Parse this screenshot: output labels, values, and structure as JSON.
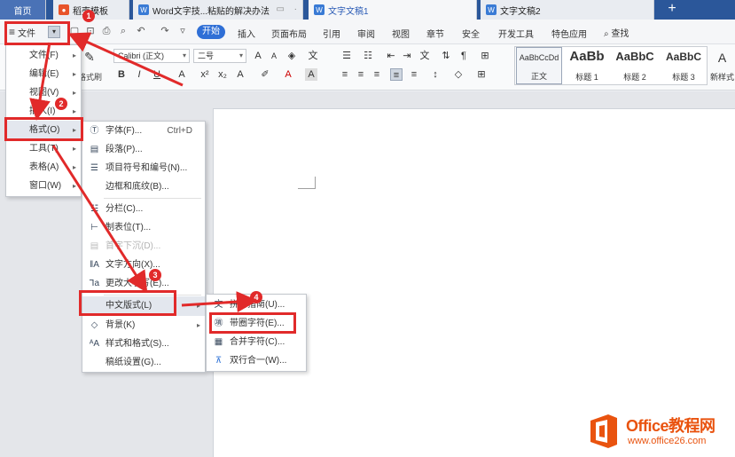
{
  "tabs": [
    {
      "label": "首页"
    },
    {
      "label": "稻壳模板"
    },
    {
      "label": "Word文字技...粘贴的解决办法"
    },
    {
      "label": "文字文稿1"
    },
    {
      "label": "文字文稿2"
    }
  ],
  "tab_add": "+",
  "menubar": {
    "file_label": "文件",
    "start_label": "开始",
    "items": [
      "插入",
      "页面布局",
      "引用",
      "审阅",
      "视图",
      "章节",
      "安全",
      "开发工具",
      "特色应用"
    ],
    "search_label": "查找"
  },
  "ribbon": {
    "font_name": "Calibri (正文)",
    "font_size": "二号",
    "format_painter": "格式刷",
    "styles": [
      {
        "preview": "AaBbCcDd",
        "label": "正文"
      },
      {
        "preview": "AaBb",
        "label": "标题 1"
      },
      {
        "preview": "AaBbC",
        "label": "标题 2"
      },
      {
        "preview": "AaBbC",
        "label": "标题 3"
      }
    ],
    "new_style": "新样式"
  },
  "file_menu": {
    "items": [
      {
        "label": "文件(F)"
      },
      {
        "label": "编辑(E)"
      },
      {
        "label": "视图(V)"
      },
      {
        "label": "插入(I)"
      },
      {
        "label": "格式(O)"
      },
      {
        "label": "工具(T)"
      },
      {
        "label": "表格(A)"
      },
      {
        "label": "窗口(W)"
      }
    ]
  },
  "format_menu": {
    "items": [
      {
        "label": "字体(F)...",
        "shortcut": "Ctrl+D"
      },
      {
        "label": "段落(P)..."
      },
      {
        "label": "项目符号和编号(N)..."
      },
      {
        "label": "边框和底纹(B)..."
      },
      {
        "label": "分栏(C)..."
      },
      {
        "label": "制表位(T)..."
      },
      {
        "label": "首字下沉(D)..."
      },
      {
        "label": "文字方向(X)..."
      },
      {
        "label": "更改大小写(E)..."
      },
      {
        "label": "中文版式(L)"
      },
      {
        "label": "背景(K)"
      },
      {
        "label": "样式和格式(S)..."
      },
      {
        "label": "稿纸设置(G)..."
      }
    ]
  },
  "chinese_layout_menu": {
    "items": [
      {
        "label": "拼音指南(U)..."
      },
      {
        "label": "带圈字符(E)..."
      },
      {
        "label": "合并字符(C)..."
      },
      {
        "label": "双行合一(W)..."
      }
    ]
  },
  "annotations": {
    "badges": [
      "1",
      "2",
      "3",
      "4"
    ],
    "color": "#e12a2a"
  },
  "watermark": {
    "name": "Office教程网",
    "url": "www.office26.com"
  }
}
